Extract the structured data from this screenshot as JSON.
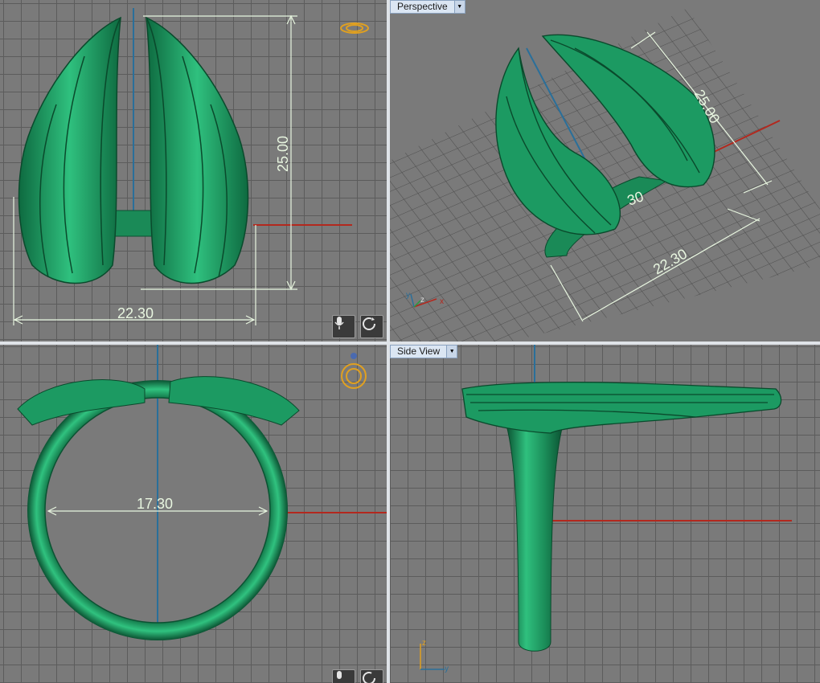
{
  "viewports": {
    "top": {
      "dims": {
        "width": "22.30",
        "height": "25.00"
      },
      "buttons": [
        "microphone-icon",
        "rotate-icon"
      ]
    },
    "perspective": {
      "label": "Perspective",
      "dims": {
        "length": "25.00",
        "width": "22.30",
        "inner": "30"
      },
      "axis": {
        "x": "x",
        "y": "y",
        "z": "z"
      }
    },
    "front": {
      "dims": {
        "diameter": "17.30"
      },
      "buttons": [
        "microphone-icon",
        "rotate-icon"
      ]
    },
    "side": {
      "label": "Side View",
      "axis": {
        "z": "z",
        "y": "y"
      }
    }
  },
  "colors": {
    "model": "#1c9a62",
    "background": "#7a7a7a",
    "grid": "#5c5c5c",
    "dimension": "#e8f6e0",
    "x_axis": "#b3281e",
    "y_axis": "#2a6f9a",
    "gizmo": "#e0a020"
  }
}
